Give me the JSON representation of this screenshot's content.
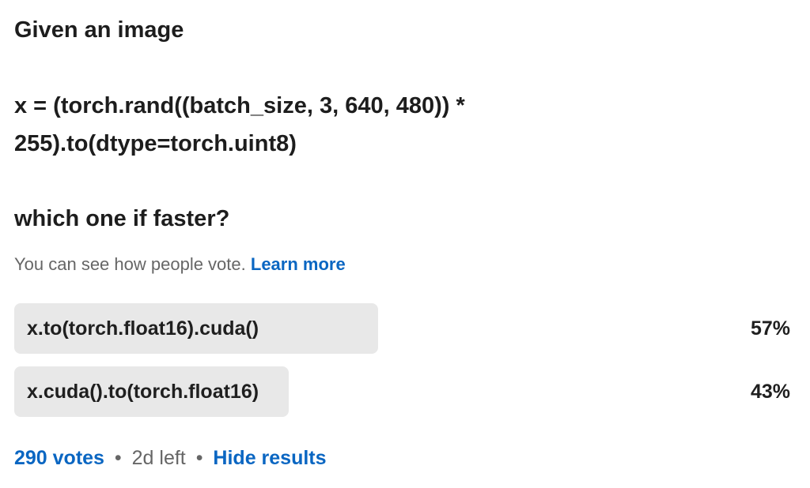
{
  "question": {
    "title": "Given an image",
    "code_line_1": "x = (torch.rand((batch_size, 3, 640, 480)) *",
    "code_line_2": "255).to(dtype=torch.uint8)",
    "ask": "which one if faster?"
  },
  "visibility": {
    "text": "You can see how people vote.",
    "link_label": "Learn more"
  },
  "options": [
    {
      "label": "x.to(torch.float16).cuda()",
      "percent_text": "57%",
      "percent": 57
    },
    {
      "label": "x.cuda().to(torch.float16)",
      "percent_text": "43%",
      "percent": 43
    }
  ],
  "footer": {
    "votes_label": "290 votes",
    "separator": "•",
    "time_left": "2d left",
    "hide_label": "Hide results"
  },
  "colors": {
    "link": "#0a66c2",
    "bar": "#e8e8e8",
    "muted_text": "#666666"
  }
}
